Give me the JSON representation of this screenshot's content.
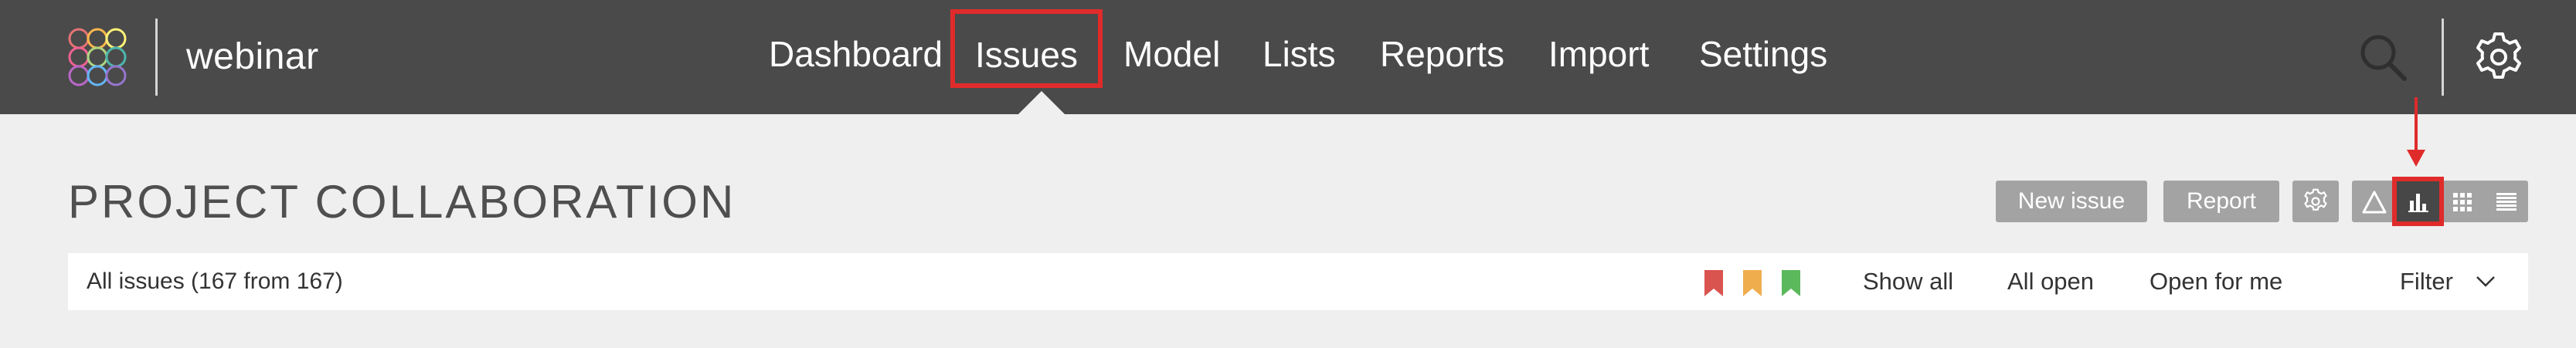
{
  "header": {
    "brand": "webinar",
    "nav": [
      {
        "label": "Dashboard",
        "active": false
      },
      {
        "label": "Issues",
        "active": true
      },
      {
        "label": "Model",
        "active": false
      },
      {
        "label": "Lists",
        "active": false
      },
      {
        "label": "Reports",
        "active": false
      },
      {
        "label": "Import",
        "active": false
      },
      {
        "label": "Settings",
        "active": false
      }
    ],
    "icons": [
      "logo-icon",
      "search-icon",
      "gear-icon"
    ]
  },
  "page": {
    "title": "PROJECT COLLABORATION"
  },
  "toolbar": {
    "new_issue_label": "New issue",
    "report_label": "Report",
    "view_modes": [
      "warning-triangle-icon",
      "bar-chart-icon",
      "grid-icon",
      "list-icon"
    ],
    "selected_view": "bar-chart-icon"
  },
  "filter_bar": {
    "summary": "All issues (167 from 167)",
    "flags": [
      {
        "name": "red-flag-icon",
        "color": "#d9534f"
      },
      {
        "name": "yellow-flag-icon",
        "color": "#f0ad4e"
      },
      {
        "name": "green-flag-icon",
        "color": "#5cb85c"
      }
    ],
    "links": [
      "Show all",
      "All open",
      "Open for me"
    ],
    "filter_label": "Filter"
  },
  "colors": {
    "topbar": "#4a4a4a",
    "highlight": "#e02b2b",
    "button": "#a3a3a3",
    "background": "#efefef"
  }
}
